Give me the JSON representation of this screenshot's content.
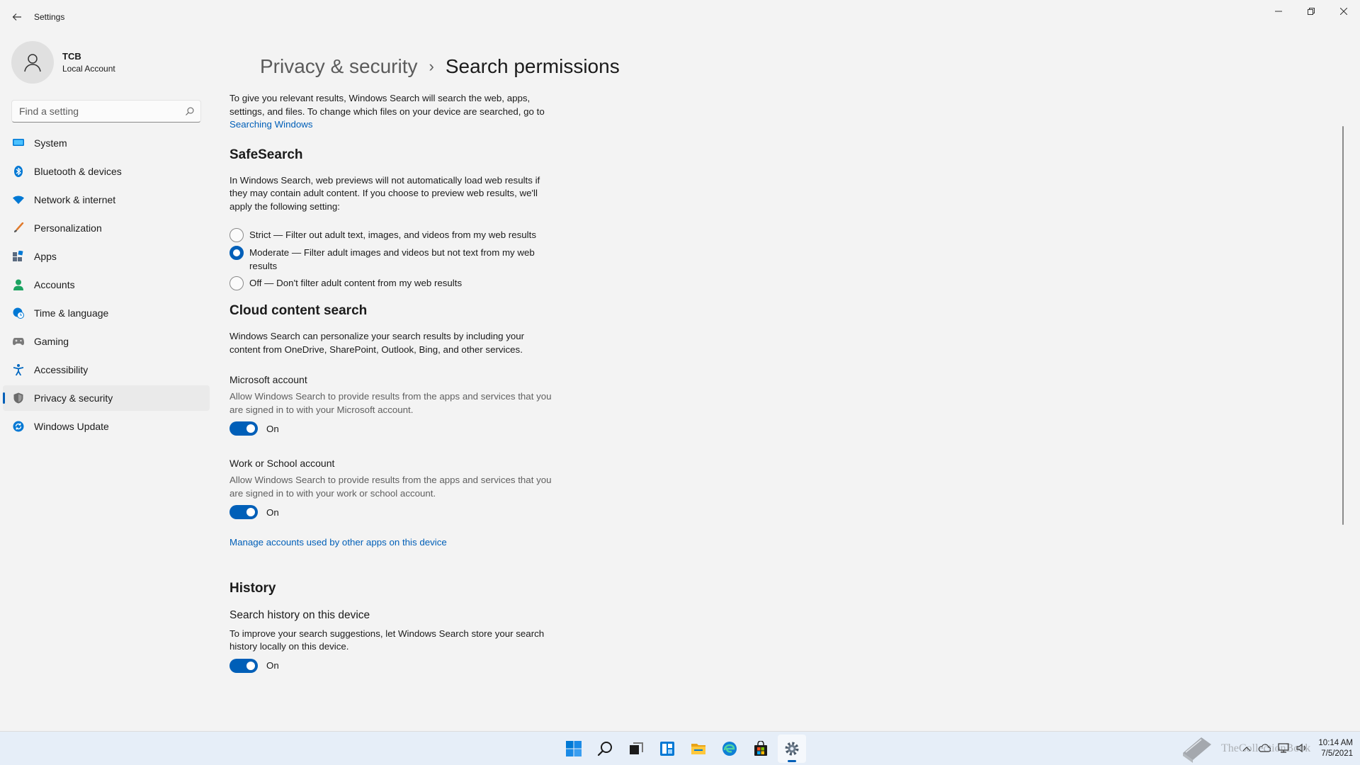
{
  "window": {
    "title": "Settings",
    "back_icon": "back-arrow-icon",
    "controls": [
      "minimize",
      "restore",
      "close"
    ]
  },
  "profile": {
    "name": "TCB",
    "account_type": "Local Account"
  },
  "search": {
    "placeholder": "Find a setting"
  },
  "nav": {
    "items": [
      {
        "label": "System",
        "icon": "monitor-icon",
        "color": "#0078d4"
      },
      {
        "label": "Bluetooth & devices",
        "icon": "bluetooth-icon",
        "color": "#0078d4"
      },
      {
        "label": "Network & internet",
        "icon": "wifi-icon",
        "color": "#0078d4"
      },
      {
        "label": "Personalization",
        "icon": "brush-icon",
        "color": "#e07a2c"
      },
      {
        "label": "Apps",
        "icon": "apps-icon",
        "color": "#5b6b80"
      },
      {
        "label": "Accounts",
        "icon": "person-icon",
        "color": "#1ca361"
      },
      {
        "label": "Time & language",
        "icon": "globe-clock-icon",
        "color": "#0078d4"
      },
      {
        "label": "Gaming",
        "icon": "gamepad-icon",
        "color": "#7a7a7a"
      },
      {
        "label": "Accessibility",
        "icon": "accessibility-icon",
        "color": "#0067c0"
      },
      {
        "label": "Privacy & security",
        "icon": "shield-icon",
        "color": "#6b6b6b"
      },
      {
        "label": "Windows Update",
        "icon": "update-icon",
        "color": "#0078d4"
      }
    ],
    "active": "Privacy & security"
  },
  "page": {
    "breadcrumb_parent": "Privacy & security",
    "breadcrumb_separator": "›",
    "title": "Search permissions",
    "intro_text": "To give you relevant results, Windows Search will search the web, apps, settings, and files. To change which files on your device are searched, go to ",
    "intro_link": "Searching Windows",
    "safesearch": {
      "heading": "SafeSearch",
      "description": "In Windows Search, web previews will not automatically load web results if they may contain adult content. If you choose to preview web results, we'll apply the following setting:",
      "options": [
        {
          "label": "Strict — Filter out adult text, images, and videos from my web results",
          "checked": false
        },
        {
          "label": "Moderate — Filter adult images and videos but not text from my web results",
          "checked": true
        },
        {
          "label": "Off — Don't filter adult content from my web results",
          "checked": false
        }
      ]
    },
    "cloud": {
      "heading": "Cloud content search",
      "description": "Windows Search can personalize your search results by including your content from OneDrive, SharePoint, Outlook, Bing, and other services.",
      "microsoft": {
        "title": "Microsoft account",
        "description": "Allow Windows Search to provide results from the apps and services that you are signed in to with your Microsoft account.",
        "state": "On"
      },
      "work": {
        "title": "Work or School account",
        "description": "Allow Windows Search to provide results from the apps and services that you are signed in to with your work or school account.",
        "state": "On"
      },
      "manage_link": "Manage accounts used by other apps on this device"
    },
    "history": {
      "heading": "History",
      "subheading": "Search history on this device",
      "description": "To improve your search suggestions, let Windows Search store your search history locally on this device.",
      "state": "On"
    }
  },
  "taskbar": {
    "apps": [
      "start-icon",
      "search-icon",
      "task-view-icon",
      "widgets-icon",
      "file-explorer-icon",
      "edge-icon",
      "store-icon",
      "settings-icon"
    ],
    "active_app": "settings-icon",
    "time": "10:14 AM",
    "date": "7/5/2021"
  },
  "watermark": {
    "text": "TheCollectionBook"
  },
  "colors": {
    "accent": "#005fb8",
    "background": "#f3f3f3",
    "link": "#005fb8"
  }
}
